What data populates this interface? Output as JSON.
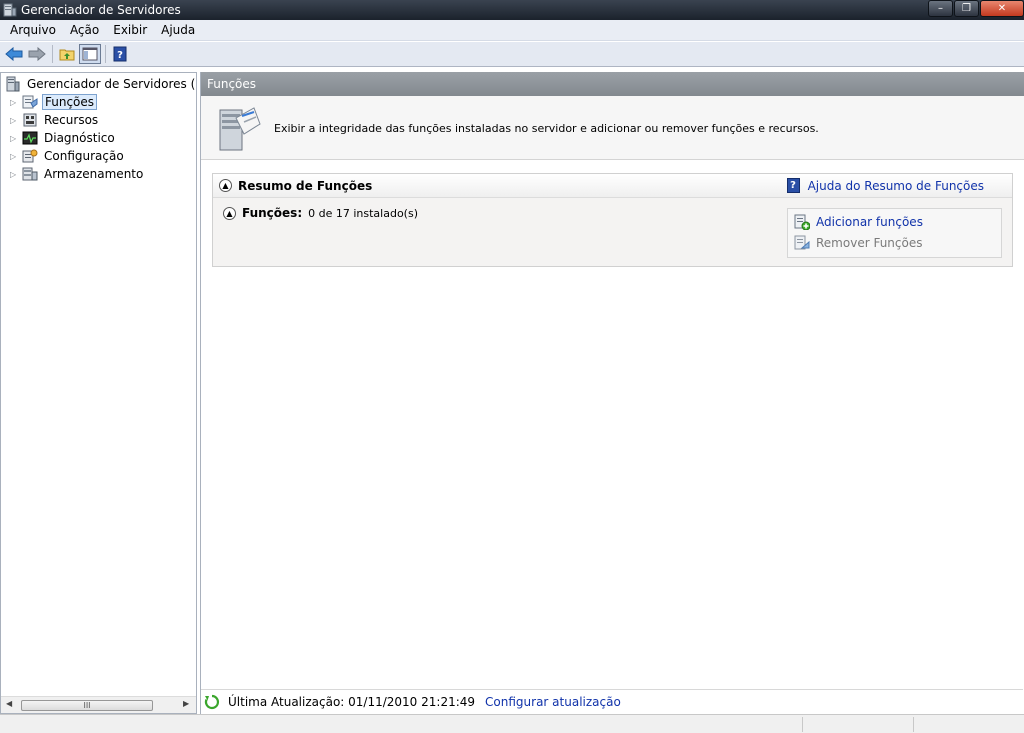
{
  "window": {
    "title": "Gerenciador de Servidores",
    "icon": "server-manager-icon",
    "controls": [
      "minimize",
      "maximize",
      "close"
    ]
  },
  "menu": {
    "items": [
      "Arquivo",
      "Ação",
      "Exibir",
      "Ajuda"
    ]
  },
  "toolbar": {
    "buttons": [
      "back-arrow-icon",
      "forward-arrow-icon",
      "up-folder-icon",
      "show-hide-tree-icon",
      "help-icon"
    ]
  },
  "tree": {
    "root_label": "Gerenciador de Servidores (SERV",
    "items": [
      {
        "label": "Funções",
        "icon": "roles-icon",
        "selected": true
      },
      {
        "label": "Recursos",
        "icon": "features-icon",
        "selected": false
      },
      {
        "label": "Diagnóstico",
        "icon": "diagnostics-icon",
        "selected": false
      },
      {
        "label": "Configuração",
        "icon": "configuration-icon",
        "selected": false
      },
      {
        "label": "Armazenamento",
        "icon": "storage-icon",
        "selected": false
      }
    ],
    "scrollbar_grip": "III"
  },
  "content": {
    "header": "Funções",
    "intro_text": "Exibir a integridade das funções instaladas no servidor e adicionar ou remover funções e recursos.",
    "section": {
      "title": "Resumo de Funções",
      "help_link": "Ajuda do Resumo de Funções",
      "roles_label": "Funções:",
      "roles_value": "0 de 17 instalado(s)",
      "actions": [
        {
          "label": "Adicionar funções",
          "enabled": true,
          "icon": "add-roles-icon"
        },
        {
          "label": "Remover Funções",
          "enabled": false,
          "icon": "remove-roles-icon"
        }
      ]
    },
    "status": {
      "last_update": "Última Atualização: 01/11/2010 21:21:49",
      "configure_link": "Configurar atualização"
    }
  },
  "colors": {
    "link": "#1133aa",
    "selection": "#dcebfc",
    "pane_header": "#8d9399"
  }
}
